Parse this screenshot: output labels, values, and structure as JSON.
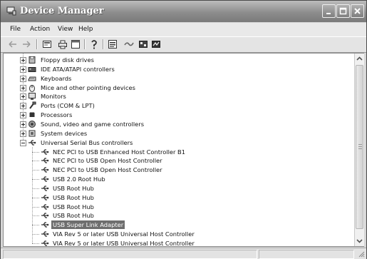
{
  "window": {
    "title": "Device Manager"
  },
  "menu": {
    "items": [
      "File",
      "Action",
      "View",
      "Help"
    ]
  },
  "toolbar": {
    "buttons": [
      "back-icon",
      "forward-icon",
      "properties-icon",
      "print-icon",
      "help-icon",
      "scan-icon",
      "update-driver-icon",
      "disable-icon",
      "uninstall-icon"
    ]
  },
  "tree": {
    "categories": [
      {
        "label": "Floppy disk drives",
        "icon": "floppy-drive-icon"
      },
      {
        "label": "IDE ATA/ATAPI controllers",
        "icon": "ide-controller-icon"
      },
      {
        "label": "Keyboards",
        "icon": "keyboard-icon"
      },
      {
        "label": "Mice and other pointing devices",
        "icon": "mouse-icon"
      },
      {
        "label": "Monitors",
        "icon": "monitor-icon"
      },
      {
        "label": "Ports (COM & LPT)",
        "icon": "port-icon"
      },
      {
        "label": "Processors",
        "icon": "processor-icon"
      },
      {
        "label": "Sound, video and game controllers",
        "icon": "sound-icon"
      },
      {
        "label": "System devices",
        "icon": "system-device-icon"
      },
      {
        "label": "Universal Serial Bus controllers",
        "icon": "usb-icon"
      }
    ],
    "usb_children": [
      "NEC PCI to USB Enhanced Host Controller B1",
      "NEC PCI to USB Open Host Controller",
      "NEC PCI to USB Open Host Controller",
      "USB 2.0 Root Hub",
      "USB Root Hub",
      "USB Root Hub",
      "USB Root Hub",
      "USB Root Hub",
      "USB Super Link Adapter",
      "VIA Rev 5 or later USB Universal Host Controller",
      "VIA Rev 5 or later USB Universal Host Controller"
    ],
    "selected_label": "USB Super Link Adapter"
  }
}
